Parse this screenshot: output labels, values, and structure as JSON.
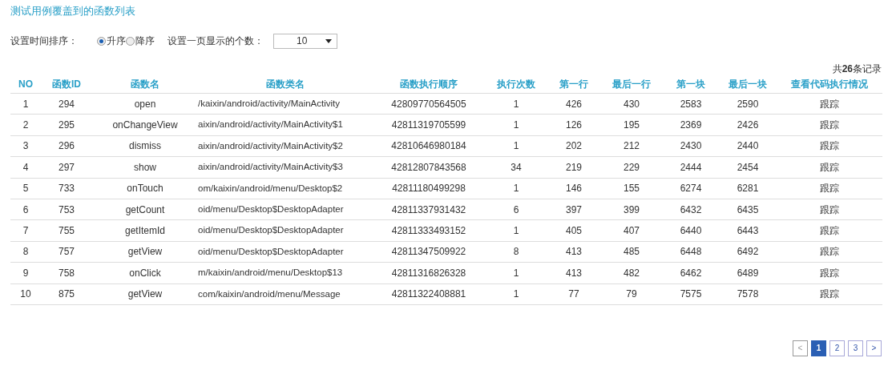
{
  "title": "测试用例覆盖到的函数列表",
  "sort": {
    "label": "设置时间排序：",
    "options": [
      {
        "label": "升序",
        "selected": true
      },
      {
        "label": "降序",
        "selected": false
      }
    ]
  },
  "page_size": {
    "label": "设置一页显示的个数：",
    "value": "10"
  },
  "record_count": "共**26**条记录",
  "table": {
    "columns": [
      "NO",
      "函数ID",
      "函数名",
      "函数类名",
      "函数执行顺序",
      "执行次数",
      "第一行",
      "最后一行",
      "第一块",
      "最后一块",
      "查看代码执行情况"
    ],
    "rows": [
      [
        "1",
        "294",
        "open",
        "/kaixin/android/activity/MainActivity",
        "42809770564505",
        "1",
        "426",
        "430",
        "2583",
        "2590",
        "跟踪"
      ],
      [
        "2",
        "295",
        "onChangeView",
        "aixin/android/activity/MainActivity$1",
        "42811319705599",
        "1",
        "126",
        "195",
        "2369",
        "2426",
        "跟踪"
      ],
      [
        "3",
        "296",
        "dismiss",
        "aixin/android/activity/MainActivity$2",
        "42810646980184",
        "1",
        "202",
        "212",
        "2430",
        "2440",
        "跟踪"
      ],
      [
        "4",
        "297",
        "show",
        "aixin/android/activity/MainActivity$3",
        "42812807843568",
        "34",
        "219",
        "229",
        "2444",
        "2454",
        "跟踪"
      ],
      [
        "5",
        "733",
        "onTouch",
        "om/kaixin/android/menu/Desktop$2",
        "42811180499298",
        "1",
        "146",
        "155",
        "6274",
        "6281",
        "跟踪"
      ],
      [
        "6",
        "753",
        "getCount",
        "oid/menu/Desktop$DesktopAdapter",
        "42811337931432",
        "6",
        "397",
        "399",
        "6432",
        "6435",
        "跟踪"
      ],
      [
        "7",
        "755",
        "getItemId",
        "oid/menu/Desktop$DesktopAdapter",
        "42811333493152",
        "1",
        "405",
        "407",
        "6440",
        "6443",
        "跟踪"
      ],
      [
        "8",
        "757",
        "getView",
        "oid/menu/Desktop$DesktopAdapter",
        "42811347509922",
        "8",
        "413",
        "485",
        "6448",
        "6492",
        "跟踪"
      ],
      [
        "9",
        "758",
        "onClick",
        "m/kaixin/android/menu/Desktop$13",
        "42811316826328",
        "1",
        "413",
        "482",
        "6462",
        "6489",
        "跟踪"
      ],
      [
        "10",
        "875",
        "getView",
        "com/kaixin/android/menu/Message",
        "42811322408881",
        "1",
        "77",
        "79",
        "7575",
        "7578",
        "跟踪"
      ]
    ]
  },
  "pagination": [
    {
      "label": "<",
      "kind": "prev",
      "selected": false
    },
    {
      "label": "1",
      "kind": "page",
      "selected": true
    },
    {
      "label": "2",
      "kind": "page",
      "selected": false
    },
    {
      "label": "3",
      "kind": "page",
      "selected": false
    },
    {
      "label": ">",
      "kind": "next",
      "selected": false
    }
  ]
}
